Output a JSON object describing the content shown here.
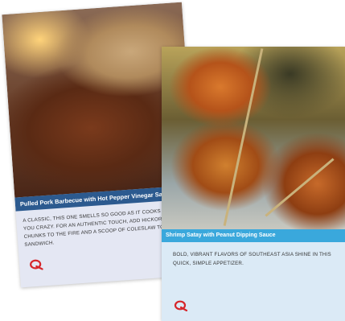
{
  "cards": [
    {
      "title": "Pulled Pork Barbecue with Hot Pepper Vinegar Sauce",
      "description": "A classic, this one smells so good as it cooks it'll drive you crazy. For an authentic touch, add hickory chips or chunks to the fire and a scoop of coleslaw to the sandwich.",
      "band_color": "#2c5a8f",
      "logo_icon": "q-logo-icon"
    },
    {
      "title": "Shrimp Satay with Peanut Dipping Sauce",
      "description": "Bold, vibrant flavors of Southeast Asia shine in this quick, simple appetizer.",
      "band_color": "#3aa8dc",
      "logo_icon": "q-logo-icon"
    }
  ],
  "logo_color": "#d6262b"
}
